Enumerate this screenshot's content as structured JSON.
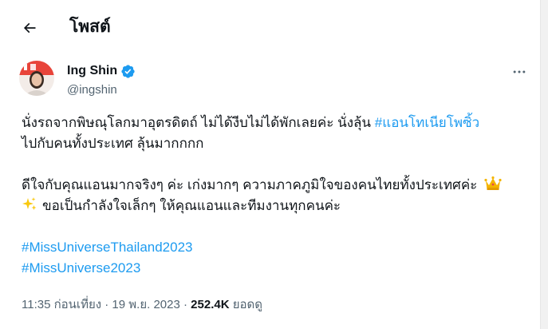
{
  "header": {
    "back_icon": "arrow-left-icon",
    "title": "โพสต์"
  },
  "author": {
    "display_name": "Ing Shin",
    "handle": "@ingshin",
    "verified_icon": "verified-badge-icon",
    "verified_color": "#1d9bf0",
    "more_icon": "more-horizontal-icon"
  },
  "tweet": {
    "line1_text": "นั่งรถจากพิษณุโลกมาอุตรดิตถ์ ไม่ได้งีบไม่ได้พักเลยค่ะ นั่งลุ้น ",
    "line1_hashtag": "#แอนโทเนียโพซิ้ว",
    "line2_text": "ไปกับคนทั้งประเทศ ลุ้นมากกกก",
    "line3_text": "ดีใจกับคุณแอนมากจริงๆ ค่ะ เก่งมากๆ ความภาคภูมิใจของคนไทยทั้งประเทศค่ะ",
    "line3_emoji": "crown-icon",
    "line4_emoji": "sparkles-icon",
    "line4_text": "ขอเป็นกำลังใจเล็กๆ ให้คุณแอนและทีมงานทุกคนค่ะ",
    "hashtag1": "#MissUniverseThailand2023",
    "hashtag2": "#MissUniverse2023"
  },
  "meta": {
    "time": "11:35 ก่อนเที่ยง",
    "separator": " · ",
    "date": "19 พ.ย. 2023",
    "views_count": "252.4K",
    "views_label": " ยอดดู"
  },
  "colors": {
    "text": "#0f1419",
    "secondary": "#536471",
    "link": "#1d9bf0"
  }
}
